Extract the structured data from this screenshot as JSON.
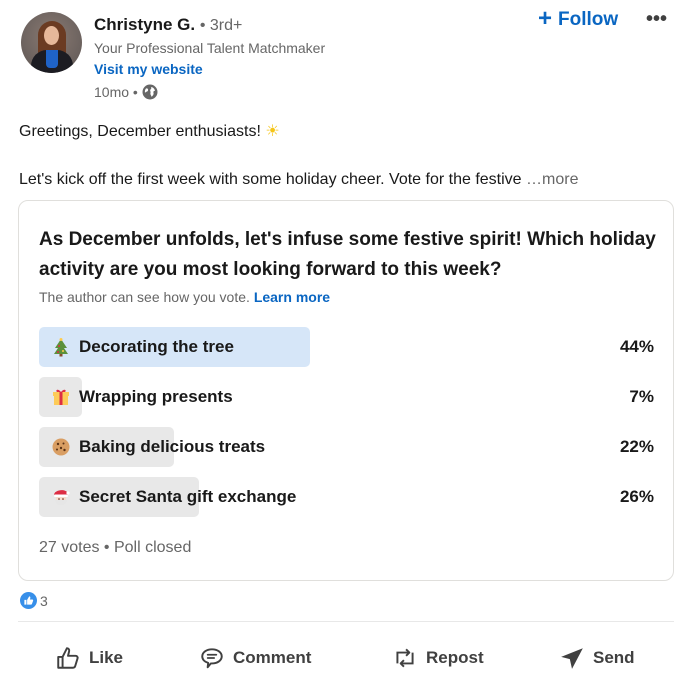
{
  "author": {
    "name": "Christyne G.",
    "degree": "• 3rd+",
    "headline": "Your Professional Talent Matchmaker",
    "website_label": "Visit my website",
    "timestamp": "10mo •",
    "visibility_icon": "globe-icon"
  },
  "header_actions": {
    "follow_label": "Follow",
    "follow_icon": "+",
    "more_label": "•••"
  },
  "post": {
    "line1": "Greetings, December enthusiasts!",
    "line1_emoji": "☀",
    "line2": "Let's kick off the first week with some holiday cheer. Vote for the festive",
    "see_more": "…more"
  },
  "poll": {
    "question": "As December unfolds, let's infuse some festive spirit! Which holiday activity are you most looking forward to this week?",
    "note": "The author can see how you vote.",
    "note_link": "Learn more",
    "options": [
      {
        "label": "Decorating the tree",
        "emoji": "christmas-tree",
        "percent": 44,
        "percent_label": "44%",
        "winner": true
      },
      {
        "label": "Wrapping presents",
        "emoji": "gift",
        "percent": 7,
        "percent_label": "7%",
        "winner": false
      },
      {
        "label": "Baking delicious treats",
        "emoji": "cookie",
        "percent": 22,
        "percent_label": "22%",
        "winner": false
      },
      {
        "label": "Secret Santa gift exchange",
        "emoji": "santa",
        "percent": 26,
        "percent_label": "26%",
        "winner": false
      }
    ],
    "footer": "27 votes • Poll closed"
  },
  "social": {
    "reaction_count": "3"
  },
  "actions": {
    "like": "Like",
    "comment": "Comment",
    "repost": "Repost",
    "send": "Send"
  },
  "colors": {
    "brand_blue": "#0a66c2",
    "winner_bar": "#d6e6f8",
    "loser_bar": "#e8e8e8"
  }
}
